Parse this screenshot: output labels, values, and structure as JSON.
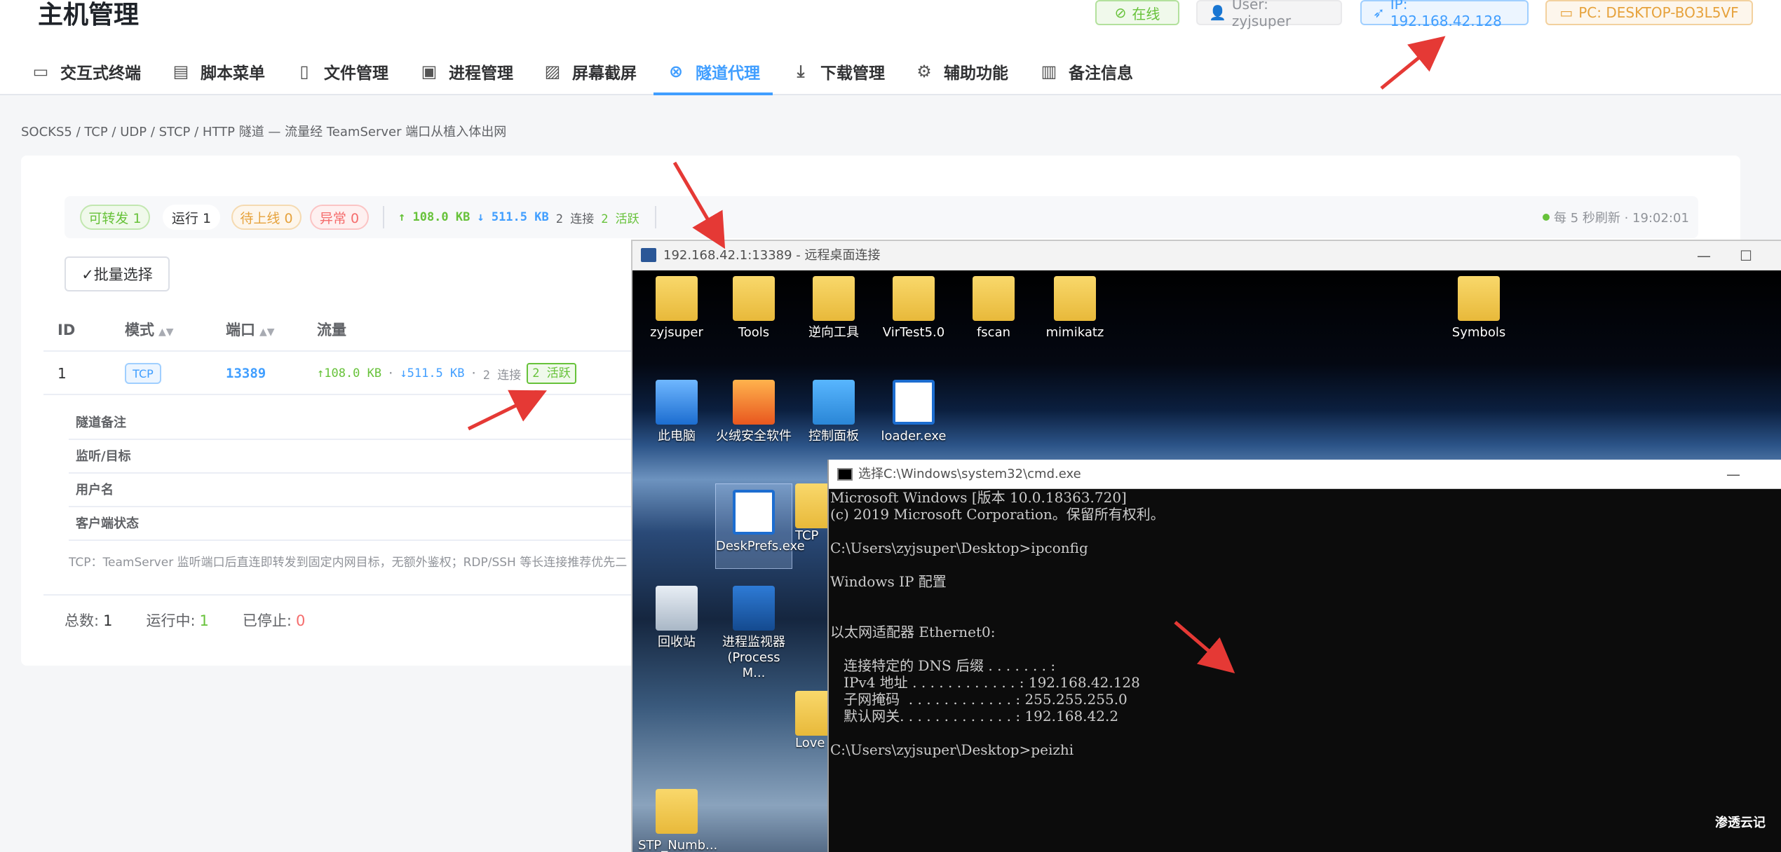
{
  "header": {
    "title": "主机管理",
    "online": "在线",
    "user": "User: zyjsuper",
    "ip": "IP: 192.168.42.128",
    "pc": "PC: DESKTOP-BO3L5VF"
  },
  "tabs": [
    {
      "label": "交互式终端",
      "icon": "monitor-icon"
    },
    {
      "label": "脚本菜单",
      "icon": "clipboard-icon"
    },
    {
      "label": "文件管理",
      "icon": "file-icon"
    },
    {
      "label": "进程管理",
      "icon": "cpu-icon"
    },
    {
      "label": "屏幕截屏",
      "icon": "image-icon"
    },
    {
      "label": "隧道代理",
      "icon": "link-icon",
      "active": true
    },
    {
      "label": "下载管理",
      "icon": "download-icon"
    },
    {
      "label": "辅助功能",
      "icon": "gear-icon"
    },
    {
      "label": "备注信息",
      "icon": "document-icon"
    }
  ],
  "description": "SOCKS5 / TCP / UDP / STCP / HTTP 隧道 — 流量经 TeamServer 端口从植入体出网",
  "status": {
    "forwardable": "可转发 1",
    "running": "运行 1",
    "pending": "待上线 0",
    "error": "异常 0",
    "up": "↑ 108.0 KB",
    "down": "↓ 511.5 KB",
    "connections": "2 连接",
    "active": "2 活跃",
    "refresh": "每 5 秒刷新 · 19:02:01"
  },
  "batch_button": "✓批量选择",
  "table": {
    "headers": {
      "id": "ID",
      "mode": "模式",
      "port": "端口",
      "traffic": "流量"
    },
    "row": {
      "id": "1",
      "mode": "TCP",
      "port": "13389",
      "up": "↑108.0 KB",
      "sep1": "·",
      "down": "↓511.5 KB",
      "sep2": "·",
      "conn": "2 连接",
      "active": "2 活跃"
    },
    "detail_labels": [
      "隧道备注",
      "监听/目标",
      "用户名",
      "客户端状态"
    ],
    "note": "TCP：TeamServer 监听端口后直连即转发到固定内网目标，无额外鉴权；RDP/SSH 等长连接推荐优先二"
  },
  "footer": {
    "total_label": "总数:",
    "total": "1",
    "running_label": "运行中:",
    "running": "1",
    "stopped_label": "已停止:",
    "stopped": "0"
  },
  "rdp": {
    "title": "192.168.42.1:13389 - 远程桌面连接",
    "icons": [
      {
        "label": "zyjsuper"
      },
      {
        "label": "Tools"
      },
      {
        "label": "逆向工具"
      },
      {
        "label": "VirTest5.0"
      },
      {
        "label": "fscan"
      },
      {
        "label": "mimikatz"
      },
      {
        "label": "Symbols"
      },
      {
        "label": "此电脑"
      },
      {
        "label": "火绒安全软件"
      },
      {
        "label": "控制面板"
      },
      {
        "label": "loader.exe"
      },
      {
        "label": "DeskPrefs.exe"
      },
      {
        "label": "TCP"
      },
      {
        "label": "回收站"
      },
      {
        "label": "进程监视器 (Process M..."
      },
      {
        "label": "Love"
      },
      {
        "label": "STP_Numb..."
      }
    ]
  },
  "cmd": {
    "title": "选择C:\\Windows\\system32\\cmd.exe",
    "lines": "Microsoft Windows [版本 10.0.18363.720]\n(c) 2019 Microsoft Corporation。保留所有权利。\n\nC:\\Users\\zyjsuper\\Desktop>ipconfig\n\nWindows IP 配置\n\n\n以太网适配器 Ethernet0:\n\n   连接特定的 DNS 后缀 . . . . . . . :\n   IPv4 地址 . . . . . . . . . . . . : 192.168.42.128\n   子网掩码  . . . . . . . . . . . . : 255.255.255.0\n   默认网关. . . . . . . . . . . . . : 192.168.42.2\n\nC:\\Users\\zyjsuper\\Desktop>peizhi"
  },
  "watermark": "渗透云记",
  "colors": {
    "accent": "#409eff",
    "success": "#67c23a",
    "warning": "#e6a23c",
    "danger": "#f56c6c",
    "annotation": "#e53935"
  }
}
